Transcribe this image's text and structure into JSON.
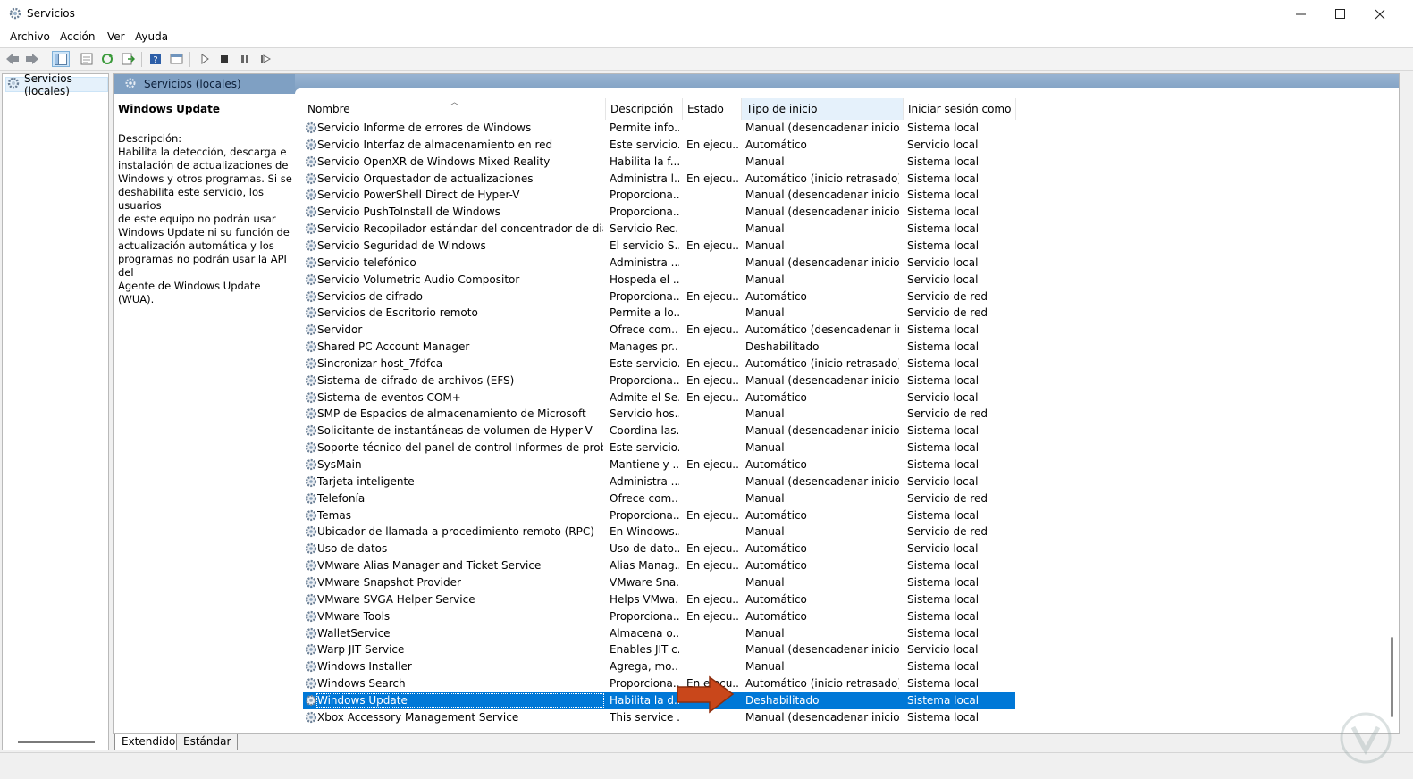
{
  "window": {
    "title": "Servicios",
    "controls": [
      "minimize",
      "maximize",
      "close"
    ]
  },
  "menu": {
    "items": [
      "Archivo",
      "Acción",
      "Ver",
      "Ayuda"
    ]
  },
  "toolbar": {
    "icons": [
      "back-icon",
      "forward-icon",
      "show-tree-icon",
      "properties-icon",
      "refresh-icon",
      "export-list-icon",
      "help-icon",
      "view-icon",
      "start-service-icon",
      "stop-service-icon",
      "pause-service-icon",
      "restart-service-icon"
    ]
  },
  "tree": {
    "root_label": "Servicios (locales)"
  },
  "banner": {
    "label": "Servicios (locales)"
  },
  "details": {
    "title": "Windows Update",
    "description_label": "Descripción:",
    "description_lines": [
      "Habilita la detección, descarga e",
      "instalación de actualizaciones de",
      "Windows y otros programas. Si se",
      "deshabilita este servicio, los usuarios",
      "de este equipo no podrán usar",
      "Windows Update ni su función de",
      "actualización automática y los",
      "programas no podrán usar la API del",
      "Agente de Windows Update (WUA)."
    ]
  },
  "table": {
    "columns": [
      "Nombre",
      "Descripción",
      "Estado",
      "Tipo de inicio",
      "Iniciar sesión como"
    ],
    "sorted_column": "Tipo de inicio",
    "rows": [
      [
        "Servicio Informe de errores de Windows",
        "Permite info...",
        "",
        "Manual (desencadenar inicio)",
        "Sistema local"
      ],
      [
        "Servicio Interfaz de almacenamiento en red",
        "Este servicio...",
        "En ejecu...",
        "Automático",
        "Servicio local"
      ],
      [
        "Servicio OpenXR de Windows Mixed Reality",
        "Habilita la f...",
        "",
        "Manual",
        "Sistema local"
      ],
      [
        "Servicio Orquestador de actualizaciones",
        "Administra l...",
        "En ejecu...",
        "Automático (inicio retrasado)",
        "Sistema local"
      ],
      [
        "Servicio PowerShell Direct de Hyper-V",
        "Proporciona...",
        "",
        "Manual (desencadenar inicio)",
        "Sistema local"
      ],
      [
        "Servicio PushToInstall de Windows",
        "Proporciona...",
        "",
        "Manual (desencadenar inicio)",
        "Sistema local"
      ],
      [
        "Servicio Recopilador estándar del concentrador de diagnós...",
        "Servicio Rec...",
        "",
        "Manual",
        "Sistema local"
      ],
      [
        "Servicio Seguridad de Windows",
        "El servicio S...",
        "En ejecu...",
        "Manual",
        "Sistema local"
      ],
      [
        "Servicio telefónico",
        "Administra ...",
        "",
        "Manual (desencadenar inicio)",
        "Servicio local"
      ],
      [
        "Servicio Volumetric Audio Compositor",
        "Hospeda el ...",
        "",
        "Manual",
        "Servicio local"
      ],
      [
        "Servicios de cifrado",
        "Proporciona...",
        "En ejecu...",
        "Automático",
        "Servicio de red"
      ],
      [
        "Servicios de Escritorio remoto",
        "Permite a lo...",
        "",
        "Manual",
        "Servicio de red"
      ],
      [
        "Servidor",
        "Ofrece com...",
        "En ejecu...",
        "Automático (desencadenar ini...",
        "Sistema local"
      ],
      [
        "Shared PC Account Manager",
        "Manages pr...",
        "",
        "Deshabilitado",
        "Sistema local"
      ],
      [
        "Sincronizar host_7fdfca",
        "Este servicio...",
        "En ejecu...",
        "Automático (inicio retrasado)",
        "Sistema local"
      ],
      [
        "Sistema de cifrado de archivos (EFS)",
        "Proporciona...",
        "En ejecu...",
        "Manual (desencadenar inicio)",
        "Sistema local"
      ],
      [
        "Sistema de eventos COM+",
        "Admite el Se...",
        "En ejecu...",
        "Automático",
        "Servicio local"
      ],
      [
        "SMP de Espacios de almacenamiento de Microsoft",
        "Servicio hos...",
        "",
        "Manual",
        "Servicio de red"
      ],
      [
        "Solicitante de instantáneas de volumen de Hyper-V",
        "Coordina las...",
        "",
        "Manual (desencadenar inicio)",
        "Sistema local"
      ],
      [
        "Soporte técnico del panel de control Informes de problemas",
        "Este servicio...",
        "",
        "Manual",
        "Sistema local"
      ],
      [
        "SysMain",
        "Mantiene y ...",
        "En ejecu...",
        "Automático",
        "Sistema local"
      ],
      [
        "Tarjeta inteligente",
        "Administra ...",
        "",
        "Manual (desencadenar inicio)",
        "Servicio local"
      ],
      [
        "Telefonía",
        "Ofrece com...",
        "",
        "Manual",
        "Servicio de red"
      ],
      [
        "Temas",
        "Proporciona...",
        "En ejecu...",
        "Automático",
        "Sistema local"
      ],
      [
        "Ubicador de llamada a procedimiento remoto (RPC)",
        "En Windows...",
        "",
        "Manual",
        "Servicio de red"
      ],
      [
        "Uso de datos",
        "Uso de dato...",
        "En ejecu...",
        "Automático",
        "Servicio local"
      ],
      [
        "VMware Alias Manager and Ticket Service",
        "Alias Manag...",
        "En ejecu...",
        "Automático",
        "Sistema local"
      ],
      [
        "VMware Snapshot Provider",
        "VMware Sna...",
        "",
        "Manual",
        "Sistema local"
      ],
      [
        "VMware SVGA Helper Service",
        "Helps VMwa...",
        "En ejecu...",
        "Automático",
        "Sistema local"
      ],
      [
        "VMware Tools",
        "Proporciona...",
        "En ejecu...",
        "Automático",
        "Sistema local"
      ],
      [
        "WalletService",
        "Almacena o...",
        "",
        "Manual",
        "Sistema local"
      ],
      [
        "Warp JIT Service",
        "Enables JIT c...",
        "",
        "Manual (desencadenar inicio)",
        "Servicio local"
      ],
      [
        "Windows Installer",
        "Agrega, mo...",
        "",
        "Manual",
        "Sistema local"
      ],
      [
        "Windows Search",
        "Proporciona...",
        "En ejecu...",
        "Automático (inicio retrasado)",
        "Sistema local"
      ],
      [
        "Windows Update",
        "Habilita la d...",
        "",
        "Deshabilitado",
        "Sistema local"
      ],
      [
        "Xbox Accessory Management Service",
        "This service ...",
        "",
        "Manual (desencadenar inicio)",
        "Sistema local"
      ]
    ],
    "selected_row": 34
  },
  "tabs": [
    "Extendido",
    "Estándar"
  ],
  "colors": {
    "selection": "#0078d7",
    "banner": "#8aa9ca",
    "annotation_arrow": "#c9471b"
  }
}
